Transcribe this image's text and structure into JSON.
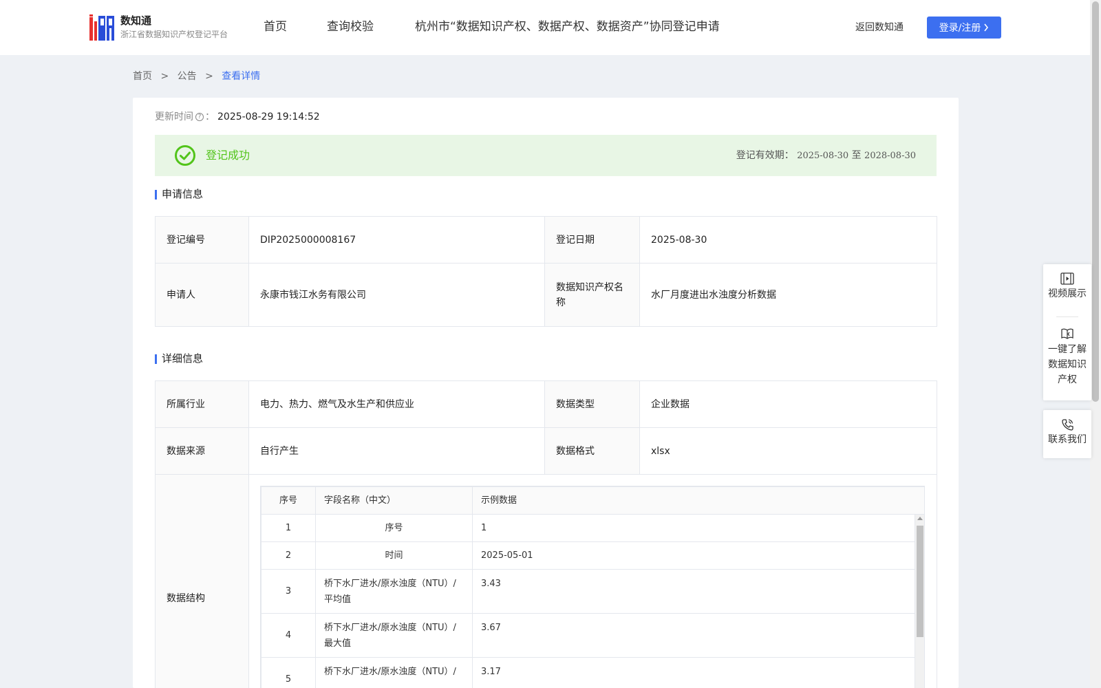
{
  "header": {
    "logo_title": "数知通",
    "logo_subtitle": "浙江省数据知识产权登记平台",
    "nav": [
      "首页",
      "查询校验",
      "杭州市“数据知识产权、数据产权、数据资产”协同登记申请"
    ],
    "back_link": "返回数知通",
    "login_label": "登录/注册"
  },
  "breadcrumb": {
    "items": [
      "首页",
      ">",
      "公告",
      ">"
    ],
    "current": "查看详情"
  },
  "update": {
    "label": "更新时间",
    "help": "?",
    "colon": "：",
    "value": "2025-08-29 19:14:52"
  },
  "status": {
    "text": "登记成功",
    "validity_label": "登记有效期：",
    "validity_from": "2025-08-30",
    "validity_to_word": "至",
    "validity_to": "2028-08-30",
    "color": "#52c41a"
  },
  "application": {
    "title": "申请信息",
    "reg_no_label": "登记编号",
    "reg_no": "DIP2025000008167",
    "reg_date_label": "登记日期",
    "reg_date": "2025-08-30",
    "applicant_label": "申请人",
    "applicant": "永康市钱江水务有限公司",
    "ip_name_label": "数据知识产权名称",
    "ip_name": "水厂月度进出水浊度分析数据"
  },
  "details": {
    "title": "详细信息",
    "industry_label": "所属行业",
    "industry": "电力、热力、燃气及水生产和供应业",
    "data_type_label": "数据类型",
    "data_type": "企业数据",
    "source_label": "数据来源",
    "source": "自行产生",
    "format_label": "数据格式",
    "format": "xlsx",
    "structure_label": "数据结构"
  },
  "structure": {
    "headers": [
      "序号",
      "字段名称（中文）",
      "示例数据"
    ],
    "rows": [
      {
        "idx": "1",
        "field": "序号",
        "sample": "1"
      },
      {
        "idx": "2",
        "field": "时间",
        "sample": "2025-05-01"
      },
      {
        "idx": "3",
        "field": "桥下水厂进水/原水浊度（NTU）/平均值",
        "sample": "3.43"
      },
      {
        "idx": "4",
        "field": "桥下水厂进水/原水浊度（NTU）/最大值",
        "sample": "3.67"
      },
      {
        "idx": "5",
        "field": "桥下水厂进水/原水浊度（NTU）/",
        "sample": "3.17"
      }
    ]
  },
  "float": {
    "video": "视频展示",
    "learn_line1": "一键了解",
    "learn_line2": "数据知识",
    "learn_line3": "产权",
    "contact": "联系我们"
  },
  "colors": {
    "accent": "#3c6ff0",
    "success_bg": "#e8f6e5",
    "success": "#52c41a"
  }
}
